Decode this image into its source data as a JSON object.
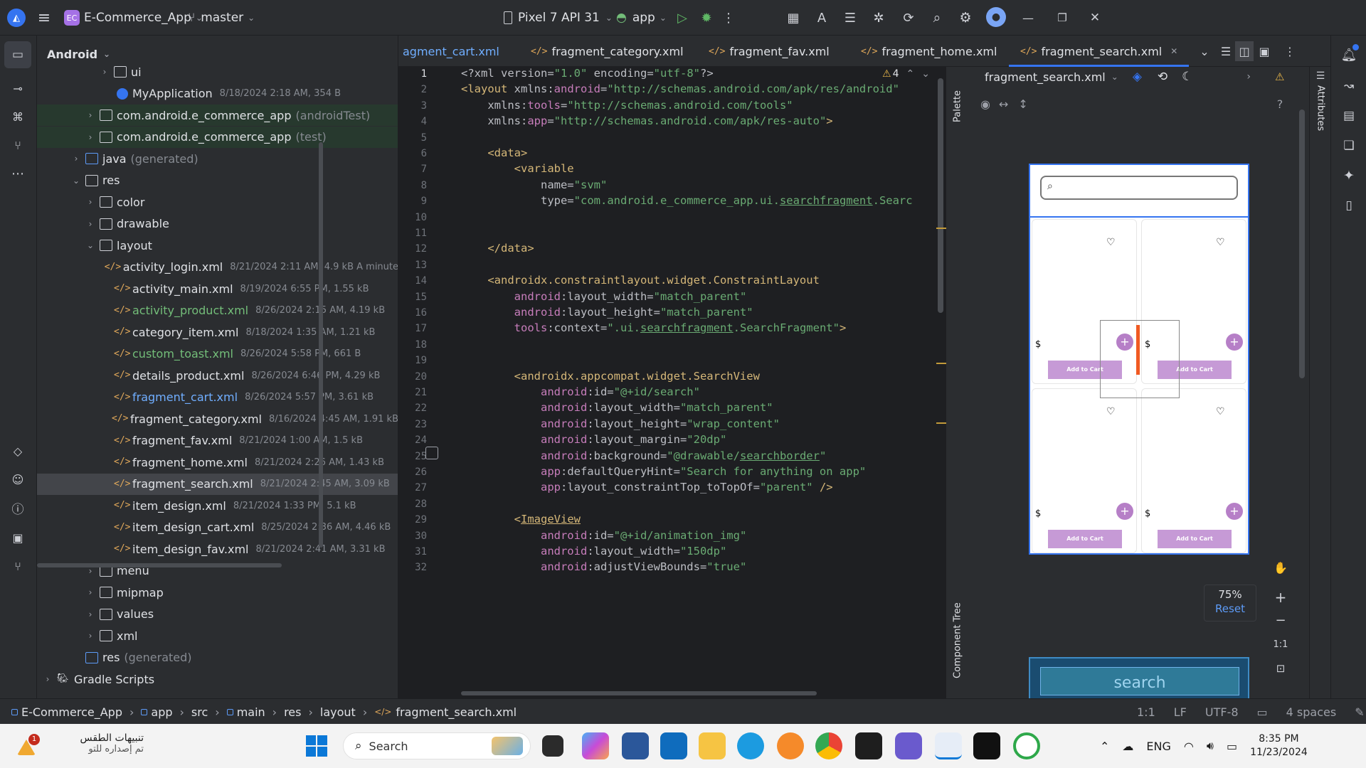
{
  "titlebar": {
    "project_badge": "EC",
    "project_name": "E-Commerce_App",
    "branch": "master",
    "device": "Pixel 7 API 31",
    "run_config": "app"
  },
  "project_panel": {
    "view_mode": "Android",
    "rows": [
      {
        "name": "ui",
        "meta": "",
        "kind": "folder",
        "expanded": false,
        "color": "#dfe1e5"
      },
      {
        "name": "MyApplication",
        "meta": "8/18/2024 2:18 AM, 354 B",
        "kind": "class",
        "expanded": null,
        "color": "#dfe1e5"
      },
      {
        "name": "com.android.e_commerce_app",
        "meta": "(androidTest)",
        "kind": "folder",
        "expanded": false,
        "color": "#dfe1e5"
      },
      {
        "name": "com.android.e_commerce_app",
        "meta": "(test)",
        "kind": "folder",
        "expanded": false,
        "color": "#dfe1e5"
      },
      {
        "name": "java",
        "meta": "(generated)",
        "kind": "folder",
        "expanded": false,
        "color": "#dfe1e5"
      },
      {
        "name": "res",
        "meta": "",
        "kind": "folder",
        "expanded": true,
        "color": "#dfe1e5"
      },
      {
        "name": "color",
        "meta": "",
        "kind": "folder",
        "expanded": false,
        "color": "#dfe1e5"
      },
      {
        "name": "drawable",
        "meta": "",
        "kind": "folder",
        "expanded": false,
        "color": "#dfe1e5"
      },
      {
        "name": "layout",
        "meta": "",
        "kind": "folder",
        "expanded": true,
        "color": "#dfe1e5"
      },
      {
        "name": "activity_login.xml",
        "meta": "8/21/2024 2:11 AM, 4.9 kB A minute",
        "kind": "xml",
        "expanded": null,
        "color": "#dfe1e5"
      },
      {
        "name": "activity_main.xml",
        "meta": "8/19/2024 6:55 PM, 1.55 kB",
        "kind": "xml",
        "expanded": null,
        "color": "#dfe1e5"
      },
      {
        "name": "activity_product.xml",
        "meta": "8/26/2024 2:15 AM, 4.19 kB",
        "kind": "xml",
        "expanded": null,
        "color": "#73bd79"
      },
      {
        "name": "category_item.xml",
        "meta": "8/18/2024 1:35 AM, 1.21 kB",
        "kind": "xml",
        "expanded": null,
        "color": "#dfe1e5"
      },
      {
        "name": "custom_toast.xml",
        "meta": "8/26/2024 5:58 PM, 661 B",
        "kind": "xml",
        "expanded": null,
        "color": "#73bd79"
      },
      {
        "name": "details_product.xml",
        "meta": "8/26/2024 6:46 PM, 4.29 kB",
        "kind": "xml",
        "expanded": null,
        "color": "#dfe1e5"
      },
      {
        "name": "fragment_cart.xml",
        "meta": "8/26/2024 5:57 PM, 3.61 kB",
        "kind": "xml",
        "expanded": null,
        "color": "#70aeff"
      },
      {
        "name": "fragment_category.xml",
        "meta": "8/16/2024 4:45 AM, 1.91 kB",
        "kind": "xml",
        "expanded": null,
        "color": "#dfe1e5"
      },
      {
        "name": "fragment_fav.xml",
        "meta": "8/21/2024 1:00 AM, 1.5 kB",
        "kind": "xml",
        "expanded": null,
        "color": "#dfe1e5"
      },
      {
        "name": "fragment_home.xml",
        "meta": "8/21/2024 2:26 AM, 1.43 kB",
        "kind": "xml",
        "expanded": null,
        "color": "#dfe1e5"
      },
      {
        "name": "fragment_search.xml",
        "meta": "8/21/2024 2:45 AM, 3.09 kB",
        "kind": "xml",
        "expanded": null,
        "color": "#dfe1e5"
      },
      {
        "name": "item_design.xml",
        "meta": "8/21/2024 1:33 PM, 5.1 kB",
        "kind": "xml",
        "expanded": null,
        "color": "#dfe1e5"
      },
      {
        "name": "item_design_cart.xml",
        "meta": "8/25/2024 2:36 AM, 4.46 kB",
        "kind": "xml",
        "expanded": null,
        "color": "#dfe1e5"
      },
      {
        "name": "item_design_fav.xml",
        "meta": "8/21/2024 2:41 AM, 3.31 kB",
        "kind": "xml",
        "expanded": null,
        "color": "#dfe1e5"
      },
      {
        "name": "menu",
        "meta": "",
        "kind": "folder",
        "expanded": false,
        "color": "#dfe1e5"
      },
      {
        "name": "mipmap",
        "meta": "",
        "kind": "folder",
        "expanded": false,
        "color": "#dfe1e5"
      },
      {
        "name": "values",
        "meta": "",
        "kind": "folder",
        "expanded": false,
        "color": "#dfe1e5"
      },
      {
        "name": "xml",
        "meta": "",
        "kind": "folder",
        "expanded": false,
        "color": "#dfe1e5"
      },
      {
        "name": "res",
        "meta": "(generated)",
        "kind": "folder",
        "expanded": null,
        "color": "#dfe1e5"
      },
      {
        "name": "Gradle Scripts",
        "meta": "",
        "kind": "gradle",
        "expanded": false,
        "color": "#dfe1e5"
      }
    ]
  },
  "tabs": [
    {
      "label": "agment_cart.xml",
      "color": "#70aeff",
      "active": false
    },
    {
      "label": "fragment_category.xml",
      "color": "#dfe1e5",
      "active": false
    },
    {
      "label": "fragment_fav.xml",
      "color": "#dfe1e5",
      "active": false
    },
    {
      "label": "fragment_home.xml",
      "color": "#dfe1e5",
      "active": false
    },
    {
      "label": "fragment_search.xml",
      "color": "#dfe1e5",
      "active": true
    }
  ],
  "editor": {
    "warnings": "4",
    "lines": [
      {
        "n": "1",
        "html": "<span class='a'>&lt;?xml version=</span><span class='s'>\"1.0\"</span><span class='a'> encoding=</span><span class='s'>\"utf-8\"</span><span class='a'>?&gt;</span>"
      },
      {
        "n": "2",
        "html": "<span class='t'>&lt;layout </span><span class='a'>xmlns:</span><span class='ns'>android</span><span class='a'>=</span><span class='s'>\"http://schemas.android.com/apk/res/android\"</span>"
      },
      {
        "n": "3",
        "html": "    <span class='a'>xmlns:</span><span class='ns'>tools</span><span class='a'>=</span><span class='s'>\"http://schemas.android.com/tools\"</span>"
      },
      {
        "n": "4",
        "html": "    <span class='a'>xmlns:</span><span class='ns'>app</span><span class='a'>=</span><span class='s'>\"http://schemas.android.com/apk/res-auto\"</span><span class='t'>&gt;</span>"
      },
      {
        "n": "5",
        "html": ""
      },
      {
        "n": "6",
        "html": "    <span class='t'>&lt;data&gt;</span>"
      },
      {
        "n": "7",
        "html": "        <span class='t'>&lt;variable</span>"
      },
      {
        "n": "8",
        "html": "            <span class='a'>name=</span><span class='s'>\"svm\"</span>"
      },
      {
        "n": "9",
        "html": "            <span class='a'>type=</span><span class='s'>\"com.android.e_commerce_app.ui.<u>searchfragment</u>.Searc</span>"
      },
      {
        "n": "10",
        "html": ""
      },
      {
        "n": "11",
        "html": ""
      },
      {
        "n": "12",
        "html": "    <span class='t'>&lt;/data&gt;</span>"
      },
      {
        "n": "13",
        "html": ""
      },
      {
        "n": "14",
        "html": "    <span class='t'>&lt;androidx.constraintlayout.widget.ConstraintLayout</span>"
      },
      {
        "n": "15",
        "html": "        <span class='ns'>android</span><span class='a'>:layout_width=</span><span class='s'>\"match_parent\"</span>"
      },
      {
        "n": "16",
        "html": "        <span class='ns'>android</span><span class='a'>:layout_height=</span><span class='s'>\"match_parent\"</span>"
      },
      {
        "n": "17",
        "html": "        <span class='ns'>tools</span><span class='a'>:context=</span><span class='s'>\".ui.<u>searchfragment</u>.SearchFragment\"</span><span class='t'>&gt;</span>"
      },
      {
        "n": "18",
        "html": ""
      },
      {
        "n": "19",
        "html": ""
      },
      {
        "n": "20",
        "html": "        <span class='t'>&lt;androidx.appcompat.widget.SearchView</span>"
      },
      {
        "n": "21",
        "html": "            <span class='ns'>android</span><span class='a'>:id=</span><span class='s'>\"@+id/search\"</span>"
      },
      {
        "n": "22",
        "html": "            <span class='ns'>android</span><span class='a'>:layout_width=</span><span class='s'>\"match_parent\"</span>"
      },
      {
        "n": "23",
        "html": "            <span class='ns'>android</span><span class='a'>:layout_height=</span><span class='s'>\"wrap_content\"</span>"
      },
      {
        "n": "24",
        "html": "            <span class='ns'>android</span><span class='a'>:layout_margin=</span><span class='s'>\"20dp\"</span>"
      },
      {
        "n": "25",
        "html": "            <span class='ns'>android</span><span class='a'>:background=</span><span class='s'>\"@drawable/<u>searchborder</u>\"</span>"
      },
      {
        "n": "26",
        "html": "            <span class='ns'>app</span><span class='a'>:defaultQueryHint=</span><span class='s'>\"Search for anything on app\"</span>"
      },
      {
        "n": "27",
        "html": "            <span class='ns'>app</span><span class='a'>:layout_constraintTop_toTopOf=</span><span class='s'>\"parent\"</span><span class='t'> /&gt;</span>"
      },
      {
        "n": "28",
        "html": ""
      },
      {
        "n": "29",
        "html": "        <span class='t'>&lt;<u>ImageView</u></span>"
      },
      {
        "n": "30",
        "html": "            <span class='ns'>android</span><span class='a'>:id=</span><span class='s'>\"@+id/animation_img\"</span>"
      },
      {
        "n": "31",
        "html": "            <span class='ns'>android</span><span class='a'>:layout_width=</span><span class='s'>\"150dp\"</span>"
      },
      {
        "n": "32",
        "html": "            <span class='ns'>android</span><span class='a'>:adjustViewBounds=</span><span class='s'>\"true\"</span>"
      }
    ]
  },
  "side_labels": {
    "palette": "Palette",
    "component_tree": "Component Tree",
    "attributes": "Attributes"
  },
  "design": {
    "file": "fragment_search.xml",
    "zoom": "75%",
    "reset": "Reset",
    "one_to_one": "1:1",
    "question": "?",
    "currency": "$",
    "add_to_cart": "Add to Cart",
    "blueprint_label": "search"
  },
  "statusbar": {
    "breadcrumbs": [
      "E-Commerce_App",
      "app",
      "src",
      "main",
      "res",
      "layout",
      "fragment_search.xml"
    ],
    "position": "1:1",
    "line_sep": "LF",
    "encoding": "UTF-8",
    "indent": "4 spaces"
  },
  "taskbar": {
    "weather_title": "تنبيهات الطقس",
    "weather_sub": "تم إصداره للتو",
    "weather_badge": "1",
    "search_label": "Search",
    "lang": "ENG",
    "time": "8:35 PM",
    "date": "11/23/2024"
  },
  "colors": {
    "accent": "#3574f0",
    "panel": "#2b2d30",
    "editor": "#1e1f22",
    "button_purple": "#c69ad6",
    "fab_purple": "#b67fc7"
  }
}
